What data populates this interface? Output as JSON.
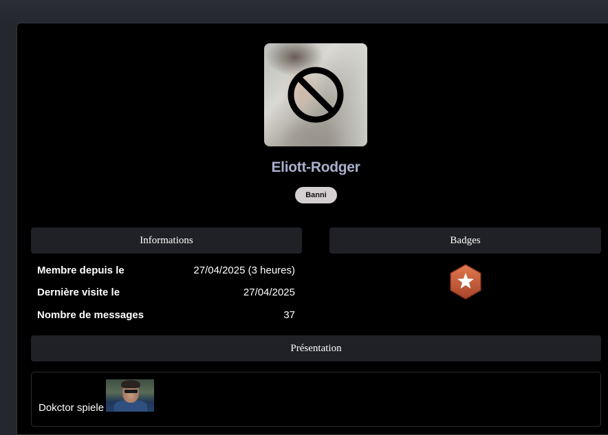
{
  "profile": {
    "username": "Eliott-Rodger",
    "status_badge": "Banni",
    "avatar_icon": "ban-icon"
  },
  "sections": {
    "informations": "Informations",
    "badges": "Badges",
    "presentation": "Présentation"
  },
  "info": [
    {
      "label": "Membre depuis le",
      "value": "27/04/2025 (3 heures)"
    },
    {
      "label": "Dernière visite le",
      "value": "27/04/2025"
    },
    {
      "label": "Nombre de messages",
      "value": "37"
    }
  ],
  "badges": [
    {
      "icon": "star-hexagon-icon",
      "color": "#c8603a"
    }
  ],
  "presentation": {
    "text": "Dokctor spiele"
  },
  "colors": {
    "username": "#a9b0cc",
    "status_badge_bg": "#d4cfd1",
    "section_header_bg": "#202126"
  }
}
